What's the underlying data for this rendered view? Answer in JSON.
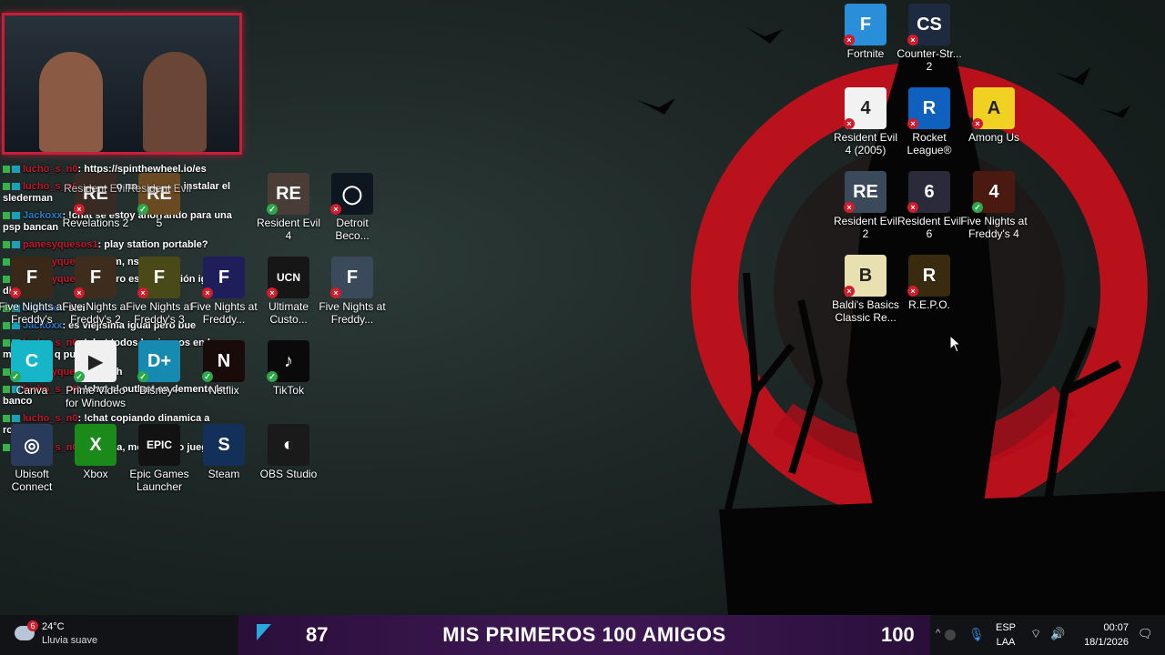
{
  "overlay": {
    "chat": [
      {
        "user": "lucho_s_n0",
        "text": ": https://spinthewheel.io/es",
        "user_color": "#c0182d"
      },
      {
        "user": "lucho_s_n0",
        "text": ": !chat yo no se como instalar el slederman",
        "user_color": "#c0182d"
      },
      {
        "user": "Jackoxx",
        "text": ": !chat se estoy ahorrando para una psp bancan",
        "user_color": "#2a7dc9"
      },
      {
        "user": "panesyquesos1",
        "text": ": play station portable?",
        "user_color": "#c0182d"
      },
      {
        "user": "panesyquesos1",
        "text": ": mm, ns",
        "user_color": "#c0182d"
      },
      {
        "user": "panesyquesos1",
        "text": ": pero es tu decisión igual, dije",
        "user_color": "#c0182d"
      },
      {
        "user": "Jackoxx",
        "text": ": sisi",
        "user_color": "#2a7dc9"
      },
      {
        "user": "Jackoxx",
        "text": ": es viejisima igual pero bue",
        "user_color": "#2a7dc9"
      },
      {
        "user": "lucho_s_n0",
        "text": ": !chat todos los juegos en lo mas dificil q puedas",
        "user_color": "#c0182d"
      },
      {
        "user": "panesyquesos1",
        "text": ": Seh",
        "user_color": "#c0182d"
      },
      {
        "user": "lucho_s_n0",
        "text": ": !chat el outlast en demente lo banco",
        "user_color": "#c0182d"
      },
      {
        "user": "lucho_s_n0",
        "text": ": !chat copiando dinamica a robleis",
        "user_color": "#c0182d"
      },
      {
        "user": "lucho_s_n0",
        "text": ": !chat na, morir y otro juego",
        "user_color": "#c0182d"
      }
    ]
  },
  "desktop": {
    "left_icons": [
      {
        "label": "Revelations 2",
        "sub": "Resident Evil",
        "status": "x",
        "color": "#3a2a24",
        "glyph": "RE"
      },
      {
        "label": "5",
        "sub": "Resident Evil",
        "status": "ok",
        "color": "#6a4a22",
        "glyph": "RE"
      },
      {
        "label": "Resident Evil 4",
        "status": "ok",
        "color": "#4a3c36",
        "glyph": "RE"
      },
      {
        "label": "Detroit Beco...",
        "status": "x",
        "color": "#0e1620",
        "glyph": "◯"
      },
      {
        "label": "Five Nights at Freddy's",
        "status": "x",
        "color": "#3a2818",
        "glyph": "F"
      },
      {
        "label": "Five Nights at Freddy's 2",
        "status": "x",
        "color": "#3e2c1c",
        "glyph": "F"
      },
      {
        "label": "Five Nights at Freddy's 3",
        "status": "x",
        "color": "#4a4a18",
        "glyph": "F"
      },
      {
        "label": "Five Nights at Freddy...",
        "status": "x",
        "color": "#1e1e5a",
        "glyph": "F"
      },
      {
        "label": "Ultimate Custo...",
        "status": "x",
        "color": "#161616",
        "glyph": "UCN"
      },
      {
        "label": "Five Nights at Freddy...",
        "status": "x",
        "color": "#3a4a5a",
        "glyph": "F"
      },
      {
        "label": "Canva",
        "status": "ok",
        "color": "#16b6c8",
        "glyph": "C"
      },
      {
        "label": "Prime Video for Windows",
        "status": "ok",
        "color": "#f0f0f0",
        "glyph": "▶"
      },
      {
        "label": "Disney+",
        "status": "ok",
        "color": "#168ab0",
        "glyph": "D+"
      },
      {
        "label": "Netflix",
        "status": "ok",
        "color": "#1a0b0b",
        "glyph": "N"
      },
      {
        "label": "TikTok",
        "status": "ok",
        "color": "#0a0a0a",
        "glyph": "♪"
      },
      {
        "label": "Ubisoft Connect",
        "status": "none",
        "color": "#2a3a5a",
        "glyph": "◎"
      },
      {
        "label": "Xbox",
        "status": "none",
        "color": "#1a8a1a",
        "glyph": "X"
      },
      {
        "label": "Epic Games Launcher",
        "status": "none",
        "color": "#121212",
        "glyph": "EPIC"
      },
      {
        "label": "Steam",
        "status": "none",
        "color": "#12305a",
        "glyph": "S"
      },
      {
        "label": "OBS Studio",
        "status": "none",
        "color": "#1a1a1a",
        "glyph": "◐"
      }
    ],
    "right_icons": [
      {
        "label": "Fortnite",
        "status": "x",
        "color": "#2a8ed8",
        "glyph": "F"
      },
      {
        "label": "Counter-Str... 2",
        "status": "x",
        "color": "#1e2a40",
        "glyph": "CS"
      },
      {
        "label": "Resident Evil 4 (2005)",
        "status": "x",
        "color": "#f2f2f2",
        "glyph": "4"
      },
      {
        "label": "Rocket League®",
        "status": "x",
        "color": "#1060c0",
        "glyph": "R"
      },
      {
        "label": "Among Us",
        "status": "x",
        "color": "#f0d020",
        "glyph": "A"
      },
      {
        "label": "Resident Evil 2",
        "status": "x",
        "color": "#3a4a5a",
        "glyph": "RE"
      },
      {
        "label": "Resident Evil 6",
        "status": "x",
        "color": "#2a2a3a",
        "glyph": "6"
      },
      {
        "label": "Five Nights at Freddy's 4",
        "status": "ok",
        "color": "#4a1a10",
        "glyph": "4"
      },
      {
        "label": "Baldi's Basics Classic Re...",
        "status": "x",
        "color": "#e8e0b0",
        "glyph": "B"
      },
      {
        "label": "R.E.P.O.",
        "status": "x",
        "color": "#3a2a10",
        "glyph": "R"
      }
    ]
  },
  "banner": {
    "count": "87",
    "title": "MIS PRIMEROS 100 AMIGOS",
    "goal": "100"
  },
  "taskbar": {
    "temperature": "24°C",
    "weather": "Lluvia suave",
    "weather_badge": "6",
    "language_top": "ESP",
    "language_bottom": "LAA",
    "time": "00:07",
    "date": "18/1/2026"
  },
  "colors": {
    "moon_red": "#d0101c",
    "banner_purple": "#3b1650",
    "chat_user_red": "#c0182d",
    "chat_user_blue": "#2a7dc9"
  }
}
